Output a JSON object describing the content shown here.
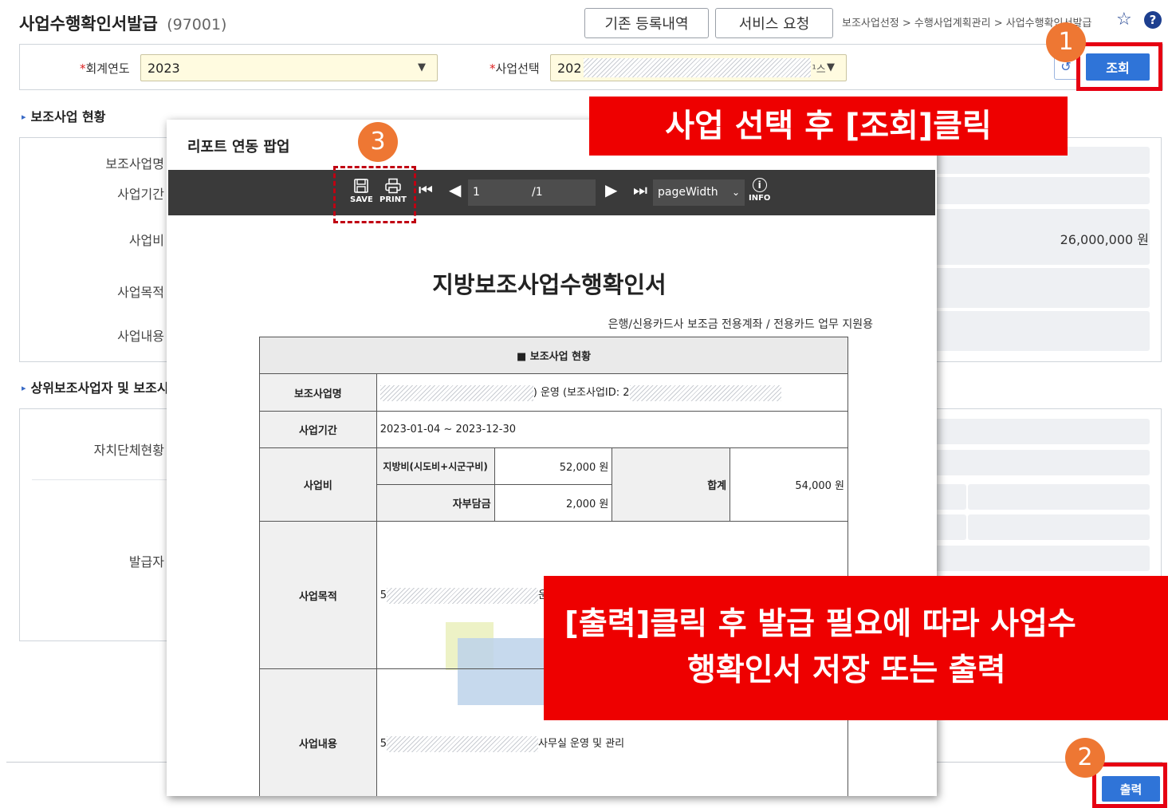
{
  "header": {
    "title": "사업수행확인서발급",
    "code": "(97001)",
    "history_button": "기존 등록내역",
    "service_button": "서비스 요청",
    "breadcrumb": "보조사업선정 > 수행사업계획관리 > 사업수행확인서발급"
  },
  "search": {
    "year_label": "회계연도",
    "year_value": "2023",
    "business_label": "사업선택",
    "business_value_prefix": "202",
    "business_value_suffix": "¹스",
    "search_button": "조회"
  },
  "background": {
    "section1_title": "보조사업 현황",
    "labels1": [
      "보조사업명",
      "사업기간",
      "사업비",
      "사업목적",
      "사업내용"
    ],
    "amount": "26,000,000 원",
    "section2_title": "상위보조사업자 및 보조시",
    "labels2": [
      "자치단체현황",
      "발급자"
    ]
  },
  "popup": {
    "title": "리포트 연동 팝업",
    "toolbar": {
      "save": "SAVE",
      "print": "PRINT",
      "page_current": "1",
      "page_total": "/1",
      "zoom": "pageWidth",
      "info": "INFO"
    },
    "document": {
      "title": "지방보조사업수행확인서",
      "subtitle": "은행/신용카드사 보조금 전용계좌 / 전용카드 업무 지원용",
      "section_header": "■ 보조사업 현황",
      "row_name_label": "보조사업명",
      "row_name_value": ") 운영 (보조사업ID: 2",
      "row_period_label": "사업기간",
      "row_period_value": "2023-01-04 ~ 2023-12-30",
      "row_cost_label": "사업비",
      "local_label": "지방비(시도비+시군구비)",
      "local_value": "52,000 원",
      "self_label": "자부담금",
      "self_value": "2,000 원",
      "sum_label": "합계",
      "sum_value": "54,000 원",
      "row_purpose_label": "사업목적",
      "row_purpose_prefix": "5",
      "row_purpose_suffix": "운",
      "row_content_label": "사업내용",
      "row_content_prefix": "5",
      "row_content_suffix": "사무실 운영 및 관리"
    }
  },
  "bottom": {
    "print_button": "출력"
  },
  "annotations": {
    "badge1": "1",
    "badge2": "2",
    "badge3": "3",
    "callout_top": "사업 선택 후 [조회]클릭",
    "callout_bottom_line1": "[출력]클릭 후 발급 필요에 따라 사업수",
    "callout_bottom_line2": "행확인서 저장 또는 출력"
  },
  "colors": {
    "accent_blue": "#2f74d8",
    "annotation_red": "#ee0000",
    "badge_orange": "#ee7733",
    "select_yellow": "#fffbe0"
  }
}
